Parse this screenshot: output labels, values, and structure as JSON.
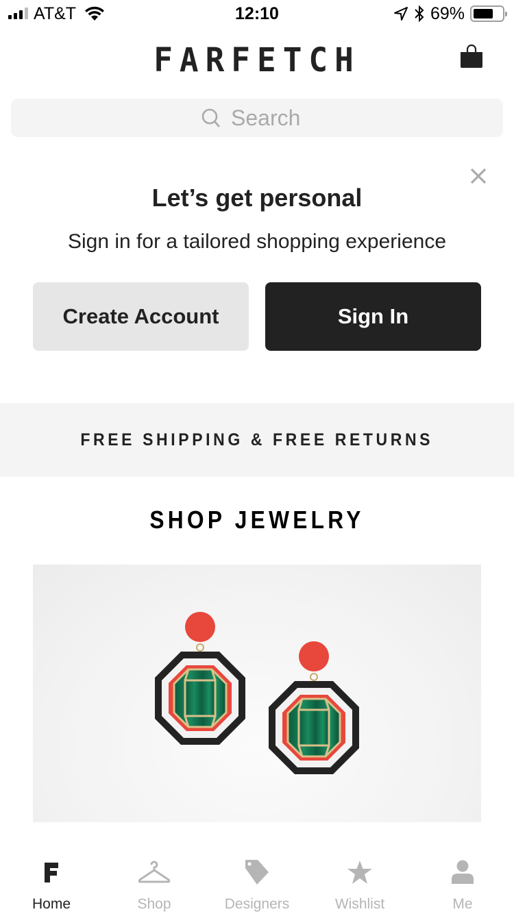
{
  "status_bar": {
    "carrier": "AT&T",
    "time": "12:10",
    "battery_percent": "69%",
    "battery_level": 0.69,
    "signal_bars": 3,
    "signal_max": 4
  },
  "header": {
    "logo": "FARFETCH",
    "bag_icon": "shopping-bag-icon"
  },
  "search": {
    "placeholder": "Search",
    "value": ""
  },
  "personal_card": {
    "title": "Let’s get personal",
    "subtitle": "Sign in for a tailored shopping experience",
    "create_account_label": "Create Account",
    "sign_in_label": "Sign In"
  },
  "banner": {
    "text": "FREE SHIPPING & FREE RETURNS"
  },
  "section": {
    "title": "SHOP JEWELRY",
    "image_alt": "Octagonal malachite and coral drop earrings"
  },
  "colors": {
    "primary_dark": "#222222",
    "inactive_gray": "#b5b5b5",
    "banner_bg": "#f4f4f4",
    "coral": "#e8473c",
    "malachite": "#0f6b4a"
  },
  "tabbar": {
    "items": [
      {
        "label": "Home",
        "icon": "farfetch-f-icon",
        "active": true
      },
      {
        "label": "Shop",
        "icon": "hanger-icon",
        "active": false
      },
      {
        "label": "Designers",
        "icon": "tag-icon",
        "active": false
      },
      {
        "label": "Wishlist",
        "icon": "star-icon",
        "active": false
      },
      {
        "label": "Me",
        "icon": "person-icon",
        "active": false
      }
    ]
  }
}
